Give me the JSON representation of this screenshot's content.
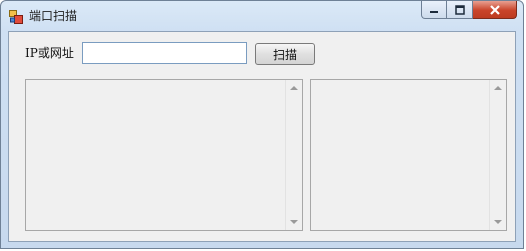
{
  "window": {
    "title": "端口扫描",
    "caption_icons": [
      "minimize-icon",
      "maximize-icon",
      "close-icon"
    ]
  },
  "form": {
    "ip_label": "IP或网址",
    "ip_value": "",
    "scan_label": "扫描"
  },
  "colors": {
    "client_bg": "#f0f0f0",
    "close_button": "#c9442a"
  }
}
